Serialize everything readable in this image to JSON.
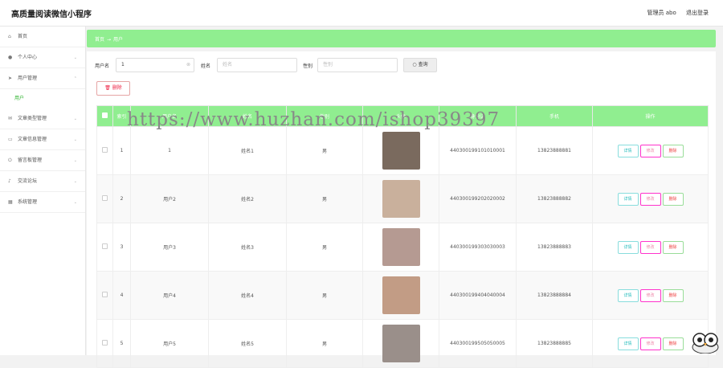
{
  "header": {
    "title": "高质量阅读微信小程序",
    "role": "管理员 abo",
    "logout": "退出登录"
  },
  "sidebar": {
    "items": [
      {
        "icon": "home-icon",
        "glyph": "⌂",
        "label": "首页",
        "chevron": false
      },
      {
        "icon": "user-icon",
        "glyph": "●",
        "label": "个人中心",
        "chevron": true
      },
      {
        "icon": "send-icon",
        "glyph": "➤",
        "label": "用户管理",
        "chevron": true
      },
      {
        "icon": "mail-icon",
        "glyph": "✉",
        "label": "文章类型管理",
        "chevron": true
      },
      {
        "icon": "chat-icon",
        "glyph": "▭",
        "label": "文章信息管理",
        "chevron": true
      },
      {
        "icon": "power-icon",
        "glyph": "⏻",
        "label": "留言板管理",
        "chevron": true
      },
      {
        "icon": "mic-icon",
        "glyph": "♪",
        "label": "交流论坛",
        "chevron": true
      },
      {
        "icon": "system-icon",
        "glyph": "▦",
        "label": "系统管理",
        "chevron": true
      }
    ],
    "sub_item": "用户"
  },
  "breadcrumb": {
    "home": "首页",
    "sep": "→",
    "current": "用户"
  },
  "search": {
    "username_label": "用户名",
    "username_value": "1",
    "name_label": "姓名",
    "name_placeholder": "姓名",
    "gender_label": "性别",
    "gender_placeholder": "性别",
    "query_label": "○ 查询"
  },
  "delete_label": "🗑 删除",
  "watermark": "https://www.huzhan.com/ishop39397",
  "table": {
    "headers": [
      "索引",
      "用户名",
      "姓名",
      "性别",
      "头像",
      "身份证",
      "手机",
      "操作"
    ],
    "rows": [
      {
        "index": "1",
        "username": "1",
        "name": "姓名1",
        "gender": "男",
        "id_card": "440300199101010001",
        "phone": "13823888881",
        "avatar_color": "#7a6a5e"
      },
      {
        "index": "2",
        "username": "用户2",
        "name": "姓名2",
        "gender": "男",
        "id_card": "440300199202020002",
        "phone": "13823888882",
        "avatar_color": "#c9b09c"
      },
      {
        "index": "3",
        "username": "用户3",
        "name": "姓名3",
        "gender": "男",
        "id_card": "440300199303030003",
        "phone": "13823888883",
        "avatar_color": "#b59a92"
      },
      {
        "index": "4",
        "username": "用户4",
        "name": "姓名4",
        "gender": "男",
        "id_card": "440300199404040004",
        "phone": "13823888884",
        "avatar_color": "#c29c85"
      },
      {
        "index": "5",
        "username": "用户5",
        "name": "姓名5",
        "gender": "男",
        "id_card": "440300199505050005",
        "phone": "13823888885",
        "avatar_color": "#9a8f8a"
      }
    ],
    "actions": {
      "detail": "详情",
      "edit": "修改",
      "delete": "删除"
    }
  },
  "colors": {
    "accent": "#90ee90",
    "danger": "#e24444"
  }
}
